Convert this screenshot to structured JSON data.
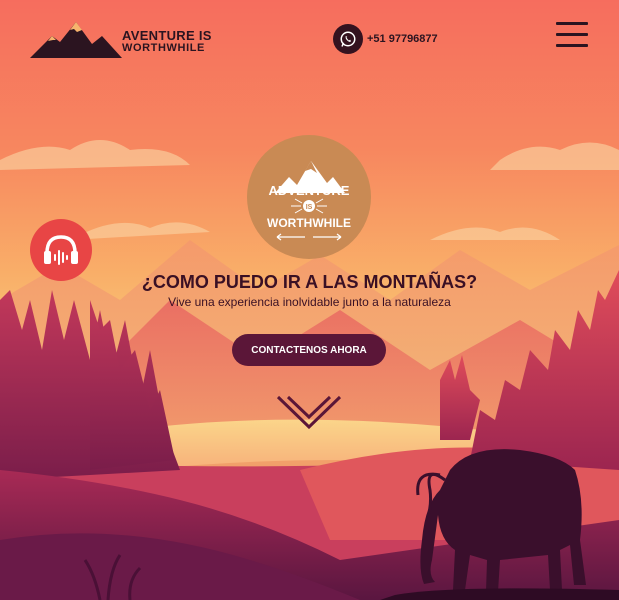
{
  "header": {
    "logo": {
      "line1": "AVENTURE IS",
      "line2": "WORTHWHILE",
      "icon": "mountain-icon"
    },
    "phone": {
      "number": "+51 97796877",
      "icon": "whatsapp-icon"
    },
    "menu": {
      "icon": "hamburger-menu-icon"
    }
  },
  "hero": {
    "emblem": {
      "line1": "ADVENTURE",
      "line2": "IS",
      "line3": "WORTHWHILE"
    },
    "audio": {
      "icon": "headphones-icon"
    },
    "title": "¿COMO PUEDO IR A LAS MONTAÑAS?",
    "subtitle": "Vive una experiencia inolvidable junto a la naturaleza",
    "cta_label": "CONTACTENOS AHORA",
    "scroll": {
      "icon": "chevrons-down-icon"
    }
  },
  "colors": {
    "sky_top": "#f66f5d",
    "sky_mid": "#f8b06a",
    "sky_low": "#f8d47d",
    "dark_text": "#3a1024",
    "cta_bg": "#5b1638",
    "audio_bg": "#e84545",
    "emblem_bg": "#c98a54"
  }
}
